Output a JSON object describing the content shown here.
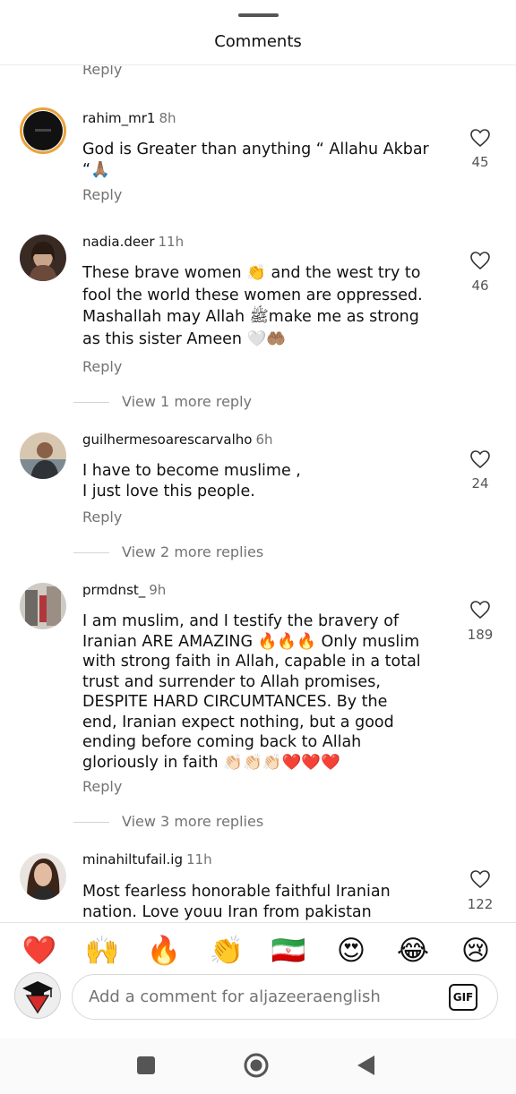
{
  "header": {
    "title": "Comments"
  },
  "top_reply": "Reply",
  "comments": [
    {
      "username": "rahim_mr1",
      "time": "8h",
      "lines": [
        "God is Greater than anything “ Allahu Akbar",
        "“🙏🏽"
      ],
      "reply": "Reply",
      "likes": "45"
    },
    {
      "username": "nadia.deer",
      "time": "11h",
      "lines": [
        "These brave women 👏 and the west try to",
        "fool the world these women are oppressed.",
        "Mashallah may Allah ﷺmake me as strong",
        "as this sister Ameen 🤍🤲🏽"
      ],
      "reply": "Reply",
      "likes": "46",
      "more": "View 1 more reply"
    },
    {
      "username": "guilhermesoarescarvalho",
      "time": "6h",
      "lines": [
        "I have to become muslime ,",
        "I just love this people."
      ],
      "reply": "Reply",
      "likes": "24",
      "more": "View 2 more replies"
    },
    {
      "username": "prmdnst_",
      "time": "9h",
      "lines": [
        "I am muslim, and I testify the bravery of",
        "Iranian ARE AMAZING 🔥🔥🔥 Only muslim",
        "with strong faith in Allah, capable in a total",
        "trust and surrender to Allah promises,",
        "DESPITE HARD CIRCUMTANCES. By the",
        "end, Iranian expect nothing, but a good",
        "ending before coming back to Allah",
        "gloriously in faith 👏🏻👏🏻👏🏻❤️❤️❤️"
      ],
      "reply": "Reply",
      "likes": "189",
      "more": "View 3 more replies"
    },
    {
      "username": "minahiltufail.ig",
      "time": "11h",
      "lines": [
        "Most fearless honorable faithful Iranian",
        "nation. Love youu Iran from pakistan"
      ],
      "likes": "122"
    }
  ],
  "emoji_bar": [
    "❤️",
    "🙌",
    "🔥",
    "👏",
    "🇮🇷",
    "😍",
    "😂",
    "😢"
  ],
  "composer": {
    "placeholder": "Add a comment for aljazeeraenglish",
    "gif_label": "GIF"
  },
  "icons": {
    "like": "heart-outline-icon",
    "nav": [
      "square-recents-icon",
      "circle-home-icon",
      "triangle-back-icon"
    ]
  },
  "colors": {
    "text": "#111111",
    "muted": "#737373",
    "divider": "#ececec"
  }
}
